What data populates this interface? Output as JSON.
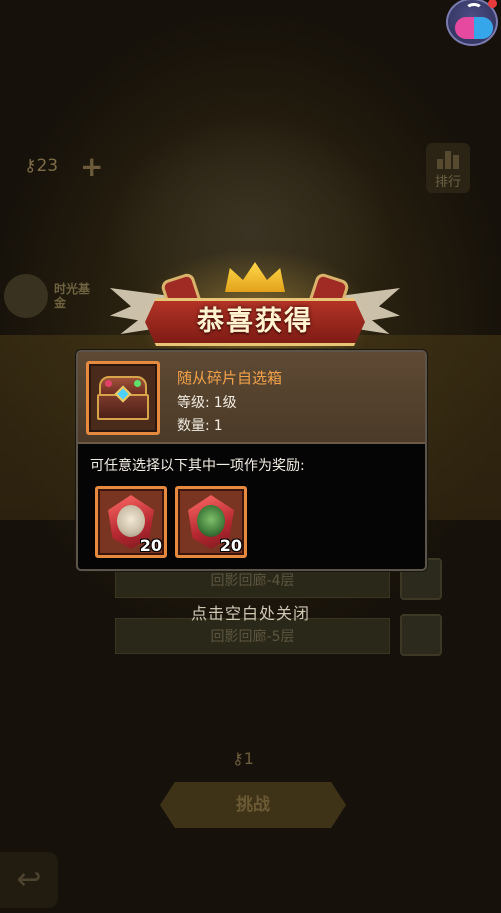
{
  "background": {
    "key_count": "23",
    "rank_label": "排行",
    "side_button_label": "时光基金",
    "rows": [
      "回影回廊-4层",
      "回影回廊-5层"
    ],
    "bottom_key_count": "1",
    "bottom_button_label": "挑战"
  },
  "title": "恭喜获得",
  "reward": {
    "name": "随从碎片自选箱",
    "level_label": "等级:",
    "level_value": "1级",
    "count_label": "数量:",
    "count_value": "1",
    "icon": "treasure-chest-icon"
  },
  "prompt": "可任意选择以下其中一项作为奖励:",
  "options": [
    {
      "icon": "white-haired-hero-shard-icon",
      "quantity": "20"
    },
    {
      "icon": "green-orc-hero-shard-icon",
      "quantity": "20"
    }
  ],
  "close_hint": "点击空白处关闭",
  "colors": {
    "accent_orange": "#e58a3f",
    "item_name": "#f3a24a",
    "ribbon_red": "#b33326"
  }
}
